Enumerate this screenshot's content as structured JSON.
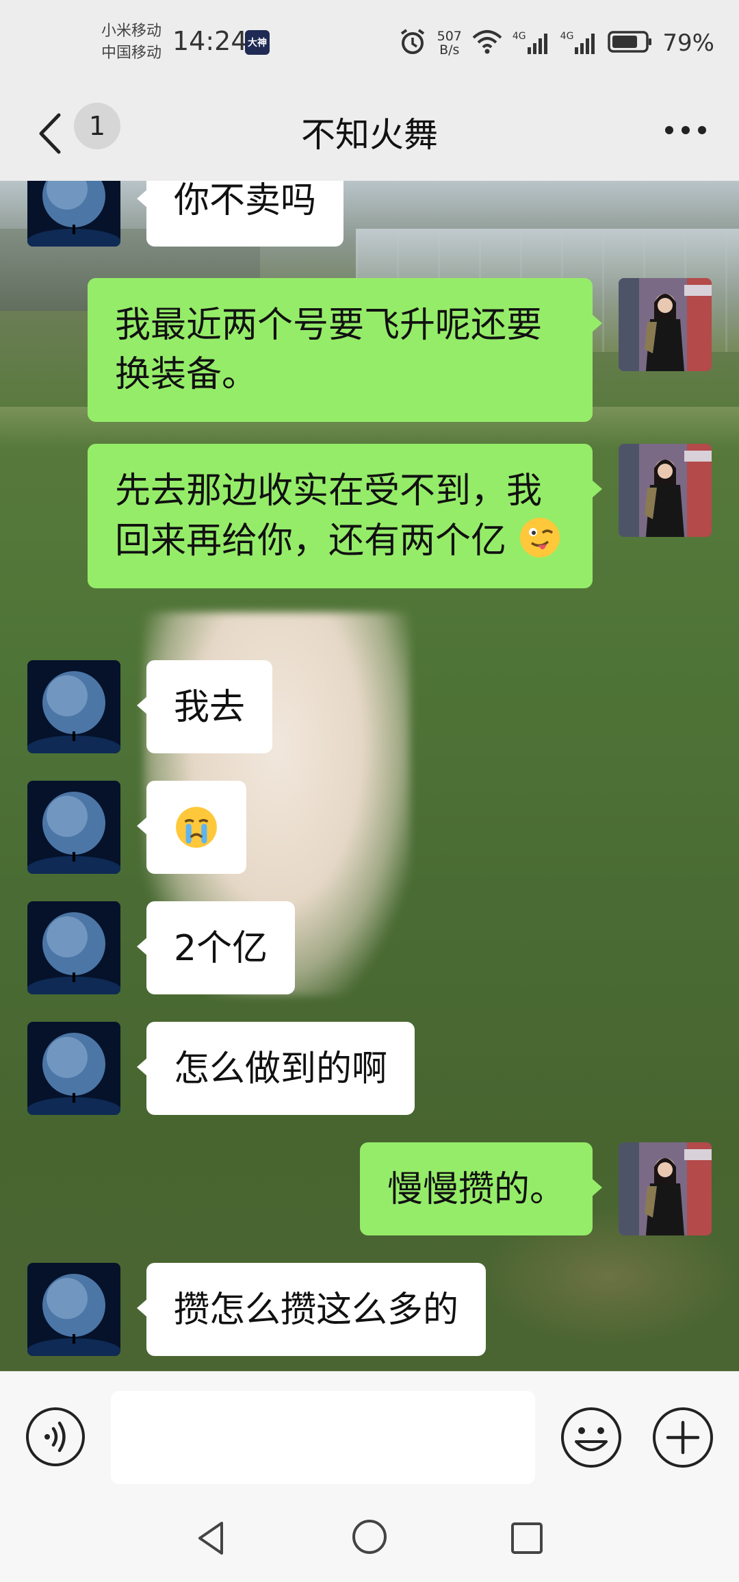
{
  "status_bar": {
    "carrier_1": "小米移动",
    "carrier_2": "中国移动",
    "time": "14:24",
    "app_badge": "大神",
    "net_speed_value": "507",
    "net_speed_unit": "B/s",
    "signal_1_label": "4G",
    "signal_2_label": "4G",
    "battery_percent": "79%",
    "battery_level": 0.79
  },
  "header": {
    "back_icon": "chevron-left-icon",
    "unread_count": "1",
    "title": "不知火舞",
    "more_icon": "more-dots-icon"
  },
  "messages": [
    {
      "side": "in",
      "text": "你不卖吗"
    },
    {
      "side": "out",
      "text": "我最近两个号要飞升呢还要换装备。"
    },
    {
      "side": "out",
      "text": "先去那边收实在受不到，我回来再给你，还有两个亿",
      "emoji": "winking-face-with-tongue"
    },
    {
      "side": "in",
      "text": "我去"
    },
    {
      "side": "in",
      "text": "",
      "emoji": "crying-face"
    },
    {
      "side": "in",
      "text": "2个亿"
    },
    {
      "side": "in",
      "text": "怎么做到的啊"
    },
    {
      "side": "out",
      "text": "慢慢攒的。"
    },
    {
      "side": "in",
      "text": "攒怎么攒这么多的"
    }
  ],
  "input_bar": {
    "voice_icon": "voice-icon",
    "input_value": "",
    "emoji_icon": "emoji-icon",
    "plus_icon": "plus-icon"
  },
  "nav_bar": {
    "back_icon": "nav-back-icon",
    "home_icon": "nav-home-icon",
    "recent_icon": "nav-recent-icon"
  },
  "colors": {
    "outgoing_bubble": "#95ec69",
    "incoming_bubble": "#ffffff",
    "bar_background": "#ededed"
  }
}
